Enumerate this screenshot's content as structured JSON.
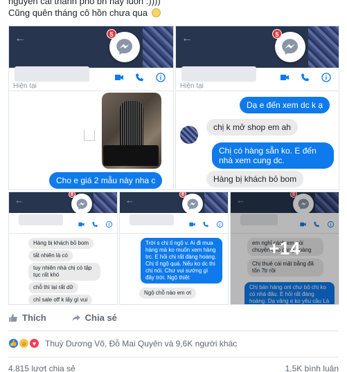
{
  "post": {
    "caption_line1": "nguyên cái thành phố bn hay luôn :))))",
    "caption_line2": "Cũng quên tháng cô hồn chưa qua",
    "caption_emoji": "slightly-smiling-face"
  },
  "screenshots": [
    {
      "badge": "5",
      "status": "Hiện tại",
      "messages": [
        {
          "from": "me",
          "text": "Cho e giá 2 mẫu này nha c"
        }
      ],
      "attachment": "dress-photo"
    },
    {
      "badge": "5",
      "status": "Hiện tại",
      "messages": [
        {
          "from": "me",
          "text": "Dạ e đến xem dc k ạ"
        },
        {
          "from": "them",
          "text": "chị k mở shop em ah"
        },
        {
          "from": "me",
          "text": "Chị có hàng sẵn ko. E đến nhà xem cung dc."
        },
        {
          "from": "them",
          "text": "Hàng bị khách bỏ bom"
        }
      ]
    },
    {
      "badge": "8",
      "messages": [
        {
          "from": "them",
          "text": "Hàng bị khách bỏ bom"
        },
        {
          "from": "them",
          "text": "tất nhiên là có"
        },
        {
          "from": "them",
          "text": "tuy nhiên nhà chị có tập tục rất khó"
        },
        {
          "from": "them",
          "text": "chỗ thì lại rất dữ"
        },
        {
          "from": "them",
          "text": "chỉ sale off k lấy gì vui"
        }
      ]
    },
    {
      "badge": "8",
      "messages": [
        {
          "from": "me",
          "text": "Trời s chị tỉ ngộ v. Ai đi mua hàng mà ko muốn xem hàng trc. E hỏi chị rất đàng hoàng. Chị tỉ ngộ quá. Nếu ko dc thì chị nói. Chư vui sướng gì đây trời. Ngộ thiệt"
        },
        {
          "from": "them",
          "text": "Ngộ chỗ nào em ơi"
        }
      ]
    },
    {
      "badge": "8",
      "more_label": "+14",
      "messages": [
        {
          "from": "them",
          "text": "em nghỉ cách em nói chuyện cho đàng hoàng"
        },
        {
          "from": "them",
          "text": "Chị thuê cái mặt bằng đã tốn 7tr rồi"
        },
        {
          "from": "me",
          "text": "Chị bán hàng onl chư bộ chị ko có nhà đâu. E hỏi rất đàng hoàng. Dạ vâng e ko yêu cầu Là chị, phải có"
        }
      ]
    }
  ],
  "actions": {
    "like_label": "Thích",
    "share_label": "Chia sẻ"
  },
  "reactions": {
    "summary": "Thuỳ Dương Võ, Đỗ Mai Quyên và 9,6K người khác"
  },
  "stats": {
    "shares": "4.815 lượt chia sẻ",
    "comments": "1,5K bình luận"
  },
  "colors": {
    "messenger_blue": "#0e7aeb",
    "header_navy": "#27354f",
    "badge_red": "#e0393e"
  }
}
